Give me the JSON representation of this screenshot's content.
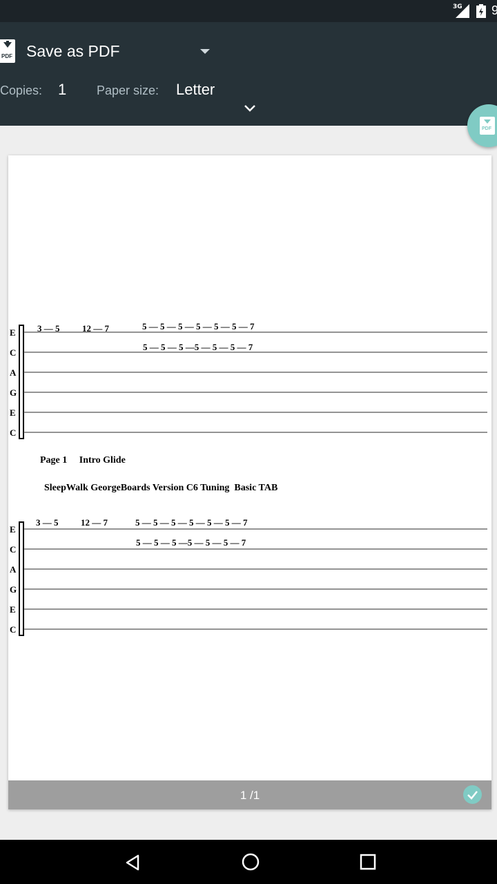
{
  "status_bar": {
    "network": "3G",
    "time": "9"
  },
  "print_header": {
    "destination": "Save as PDF",
    "copies_label": "Copies:",
    "copies_value": "1",
    "paper_size_label": "Paper size:",
    "paper_size_value": "Letter"
  },
  "fab": {
    "icon": "pdf-download-icon",
    "label": "PDF"
  },
  "pdf_icon_label": "PDF",
  "preview": {
    "page_indicator": "1 /1",
    "document": {
      "staff1": {
        "strings": [
          "E",
          "C",
          "A",
          "G",
          "E",
          "C"
        ],
        "line1": [
          "3 — 5",
          "12 — 7",
          "5 — 5 — 5 — 5 — 5 — 5 — 7"
        ],
        "line2": "5 — 5 — 5 —5 — 5 — 5 — 7"
      },
      "caption1": "Page 1     Intro Glide",
      "caption2": "SleepWalk GeorgeBoards Version C6 Tuning  Basic TAB",
      "staff2": {
        "strings": [
          "E",
          "C",
          "A",
          "G",
          "E",
          "C"
        ],
        "line1": [
          "3 — 5",
          "12 — 7",
          "5 — 5 — 5 — 5 — 5 — 5 — 7"
        ],
        "line2": "5 — 5 — 5 —5 — 5 — 5 — 7"
      }
    }
  },
  "colors": {
    "header_bg": "#263238",
    "accent": "#80cbc4",
    "footer_bg": "#9e9e9e"
  }
}
